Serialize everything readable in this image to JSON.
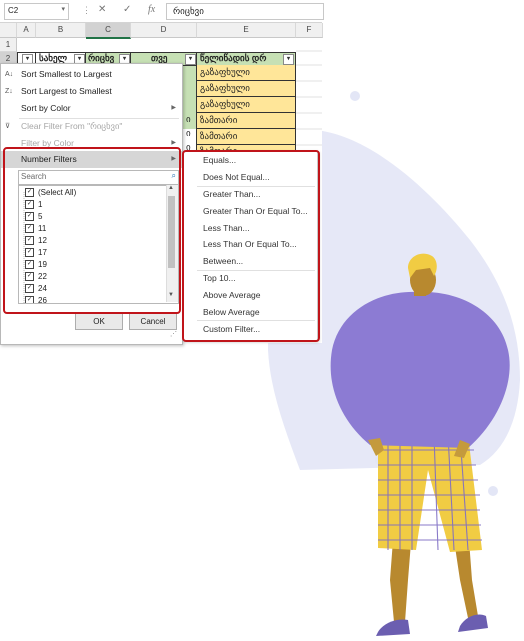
{
  "name_box": "C2",
  "formula_value": "რიცხვი",
  "formula_icons": [
    "cancel-icon",
    "confirm-icon",
    "function-icon"
  ],
  "columns": [
    "A",
    "B",
    "C",
    "D",
    "E",
    "F"
  ],
  "rows": [
    "1",
    "2"
  ],
  "header_row": {
    "b": "სახელ",
    "c": "რიცხვ",
    "d": "თვე",
    "e": "წელიწადის დრ"
  },
  "visible_d_fragments": [
    "ი",
    "ი",
    "ი"
  ],
  "season_values": [
    "გაზაფხული",
    "გაზაფხული",
    "გაზაფხული",
    "ზამთარი",
    "ზამთარი",
    "ზამთარი"
  ],
  "sort_menu": [
    {
      "label": "Sort Smallest to Largest",
      "icon": "sort-asc-icon",
      "disabled": false
    },
    {
      "label": "Sort Largest to Smallest",
      "icon": "sort-desc-icon",
      "disabled": false
    },
    {
      "label": "Sort by Color",
      "icon": "",
      "disabled": false
    },
    {
      "label": "Clear Filter From \"რიცხვი\"",
      "icon": "clear-filter-icon",
      "disabled": true
    },
    {
      "label": "Filter by Color",
      "icon": "",
      "disabled": true
    },
    {
      "label": "Number Filters",
      "icon": "",
      "disabled": false
    }
  ],
  "search_placeholder": "Search",
  "checklist": [
    "(Select All)",
    "1",
    "5",
    "11",
    "12",
    "17",
    "19",
    "22",
    "24",
    "26"
  ],
  "ok_label": "OK",
  "cancel_label": "Cancel",
  "number_filters": [
    "Equals...",
    "Does Not Equal...",
    "Greater Than...",
    "Greater Than Or Equal To...",
    "Less Than...",
    "Less Than Or Equal To...",
    "Between...",
    "Top 10...",
    "Above Average",
    "Below Average",
    "Custom Filter..."
  ],
  "colors": {
    "highlight_red": "#c0141a",
    "header_green": "#c6e0b4",
    "cell_yellow": "#ffe699",
    "figure_purple": "#8c7bd3",
    "pants_yellow": "#f1cc43"
  }
}
